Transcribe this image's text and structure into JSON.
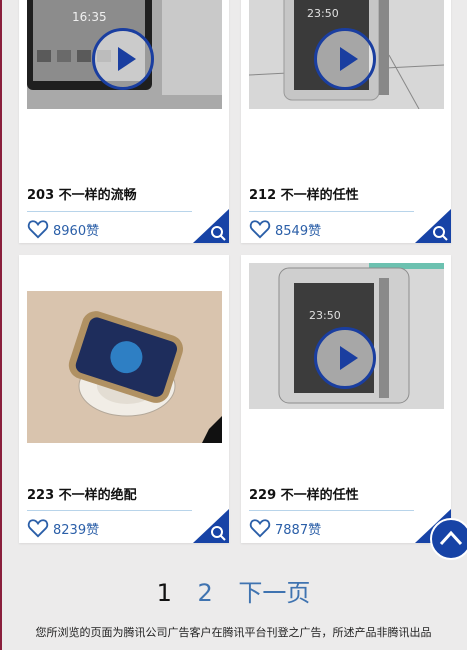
{
  "cards": [
    {
      "title": "203 不一样的流畅",
      "likes": "8960赞",
      "has_video": true,
      "phone_time": "16:35"
    },
    {
      "title": "212 不一样的任性",
      "likes": "8549赞",
      "has_video": true,
      "phone_time": "23:50"
    },
    {
      "title": "223 不一样的绝配",
      "likes": "8239赞",
      "has_video": false,
      "phone_time": ""
    },
    {
      "title": "229 不一样的任性",
      "likes": "7887赞",
      "has_video": true,
      "phone_time": "23:50"
    }
  ],
  "pagination": {
    "current": "1",
    "page2": "2",
    "next": "下一页"
  },
  "footer": {
    "notice": "您所浏览的页面为腾讯公司广告客户在腾讯平台刊登之广告，所述产品非腾讯出品"
  },
  "colors": {
    "accent": "#1743a6",
    "link": "#3f73b0",
    "background": "#ecebeb"
  },
  "icons": {
    "like": "heart-icon",
    "search": "magnifier-icon",
    "play": "play-icon",
    "back_to_top": "chevron-up-icon"
  }
}
